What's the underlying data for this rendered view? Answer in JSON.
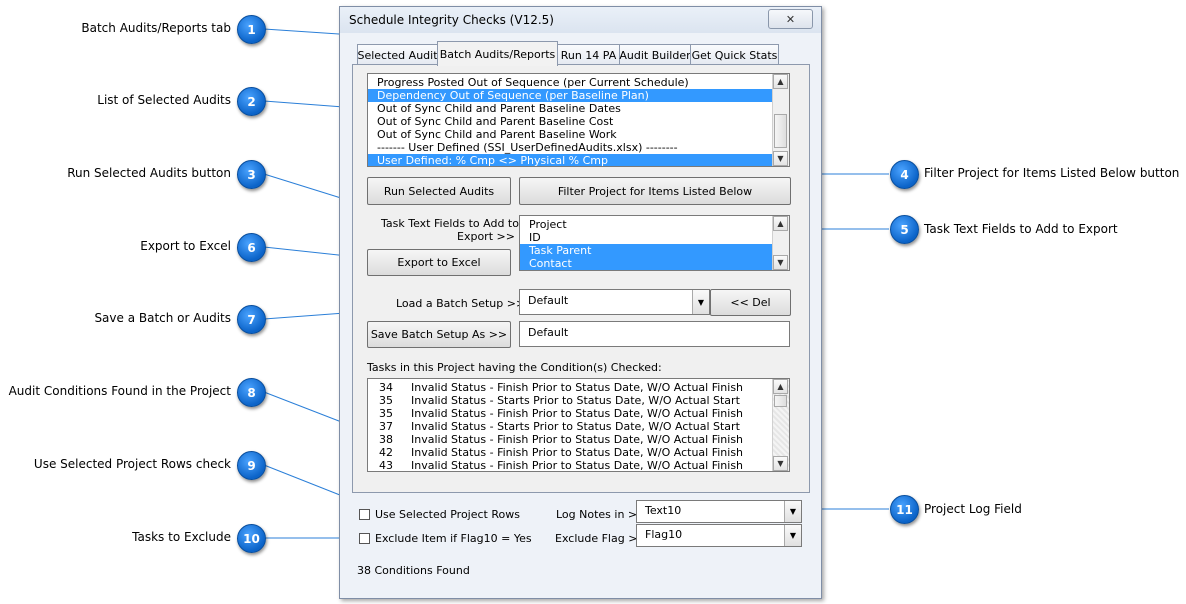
{
  "callouts": [
    {
      "num": "1",
      "label": "Batch Audits/Reports tab"
    },
    {
      "num": "2",
      "label": "List of Selected Audits"
    },
    {
      "num": "3",
      "label": "Run Selected Audits button"
    },
    {
      "num": "4",
      "label": "Filter Project for Items Listed Below button"
    },
    {
      "num": "5",
      "label": "Task Text  Fields to Add to Export"
    },
    {
      "num": "6",
      "label": "Export to Excel"
    },
    {
      "num": "7",
      "label": "Save a Batch or Audits"
    },
    {
      "num": "8",
      "label": "Audit Conditions Found in the Project"
    },
    {
      "num": "9",
      "label": "Use Selected Project Rows check"
    },
    {
      "num": "10",
      "label": "Tasks to Exclude"
    },
    {
      "num": "11",
      "label": "Project Log Field"
    }
  ],
  "dialog": {
    "title": "Schedule Integrity Checks (V12.5)",
    "close_glyph": "✕",
    "tabs": [
      "Selected Audit",
      "Batch Audits/Reports",
      "Run 14 PA",
      "Audit Builder",
      "Get Quick Stats"
    ],
    "active_tab": "Batch Audits/Reports",
    "audits": [
      {
        "text": "Progress Posted Out of Sequence (per Current Schedule)",
        "selected": false
      },
      {
        "text": "Dependency Out of Sequence (per Baseline Plan)",
        "selected": true
      },
      {
        "text": "Out of Sync Child and Parent Baseline Dates",
        "selected": false
      },
      {
        "text": "Out of Sync Child and Parent Baseline Cost",
        "selected": false
      },
      {
        "text": "Out of Sync Child and Parent Baseline Work",
        "selected": false
      },
      {
        "text": "------- User Defined (SSI_UserDefinedAudits.xlsx) --------",
        "selected": false
      },
      {
        "text": "User Defined: % Cmp <> Physical % Cmp",
        "selected": true
      }
    ],
    "run_button": "Run Selected Audits",
    "filter_button": "Filter Project for Items Listed Below",
    "task_text_label_1": "Task Text  Fields to Add to",
    "task_text_label_2": "Export >>",
    "fields": [
      {
        "text": "Project",
        "selected": false
      },
      {
        "text": "ID",
        "selected": false
      },
      {
        "text": "Task Parent",
        "selected": true
      },
      {
        "text": "Contact",
        "selected": true
      }
    ],
    "export_button": "Export to Excel",
    "load_label": "Load a Batch Setup >>",
    "load_value": "Default",
    "del_button": "<< Del",
    "save_button": "Save Batch Setup As >>",
    "save_value": "Default",
    "tasks_label": "Tasks in this Project having the Condition(s) Checked:",
    "tasks": [
      {
        "id": "34",
        "desc": "Invalid Status - Finish Prior to Status Date, W/O Actual Finish"
      },
      {
        "id": "35",
        "desc": "Invalid Status - Starts Prior to Status Date, W/O Actual Start"
      },
      {
        "id": "35",
        "desc": "Invalid Status - Finish Prior to Status Date, W/O Actual Finish"
      },
      {
        "id": "37",
        "desc": "Invalid Status - Starts Prior to Status Date, W/O Actual Start"
      },
      {
        "id": "38",
        "desc": "Invalid Status - Finish Prior to Status Date, W/O Actual Finish"
      },
      {
        "id": "42",
        "desc": "Invalid Status - Finish Prior to Status Date, W/O Actual Finish"
      },
      {
        "id": "43",
        "desc": "Invalid Status - Finish Prior to Status Date, W/O Actual Finish"
      }
    ],
    "use_rows_label": "Use Selected Project Rows",
    "exclude_label": "Exclude Item if Flag10 = Yes",
    "log_label": "Log Notes in >",
    "log_value": "Text10",
    "flag_label": "Exclude Flag >",
    "flag_value": "Flag10",
    "status": "38 Conditions Found"
  },
  "colors": {
    "accent": "#3399ff",
    "callout": "#0b63c8",
    "line": "#1a73e8"
  }
}
